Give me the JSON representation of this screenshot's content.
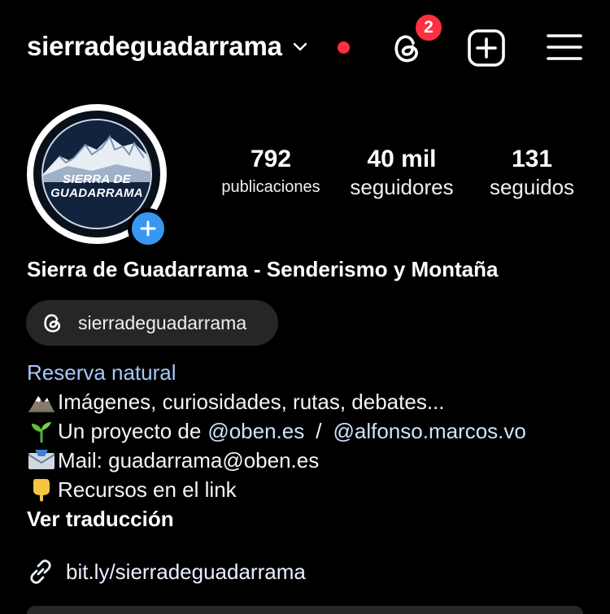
{
  "header": {
    "username": "sierradeguadarrama",
    "threads_badge_count": "2"
  },
  "avatar": {
    "text_line1": "SIERRA DE",
    "text_line2": "GUADARRAMA"
  },
  "stats": {
    "posts_value": "792",
    "posts_label": "publicaciones",
    "followers_value": "40 mil",
    "followers_label": "seguidores",
    "following_value": "131",
    "following_label": "seguidos"
  },
  "profile": {
    "name": "Sierra de Guadarrama - Senderismo y Montaña",
    "threads_handle": "sierradeguadarrama",
    "category": "Reserva natural",
    "bio_line1": "Imágenes, curiosidades, rutas, debates...",
    "bio_line2_prefix": "Un proyecto de",
    "bio_mention1": "@oben.es",
    "bio_separator": "/",
    "bio_mention2": "@alfonso.marcos.vo",
    "bio_line3": "Mail: guadarrama@oben.es",
    "bio_line4": "Recursos en el link",
    "translate_label": "Ver traducción",
    "link": "bit.ly/sierradeguadarrama"
  },
  "colors": {
    "background": "#000000",
    "badge": "#ff3040",
    "add_story": "#3897f0",
    "pill": "#262626",
    "category": "#a8c7fa"
  },
  "icons": {
    "threads": "threads-icon",
    "add": "plus-square-icon",
    "menu": "hamburger-menu-icon",
    "chevron": "chevron-down-icon",
    "link": "link-icon",
    "mountain_emoji": "mountain-emoji-icon",
    "seedling_emoji": "seedling-emoji-icon",
    "mail_emoji": "envelope-emoji-icon",
    "pointing_emoji": "pointing-down-emoji-icon"
  }
}
